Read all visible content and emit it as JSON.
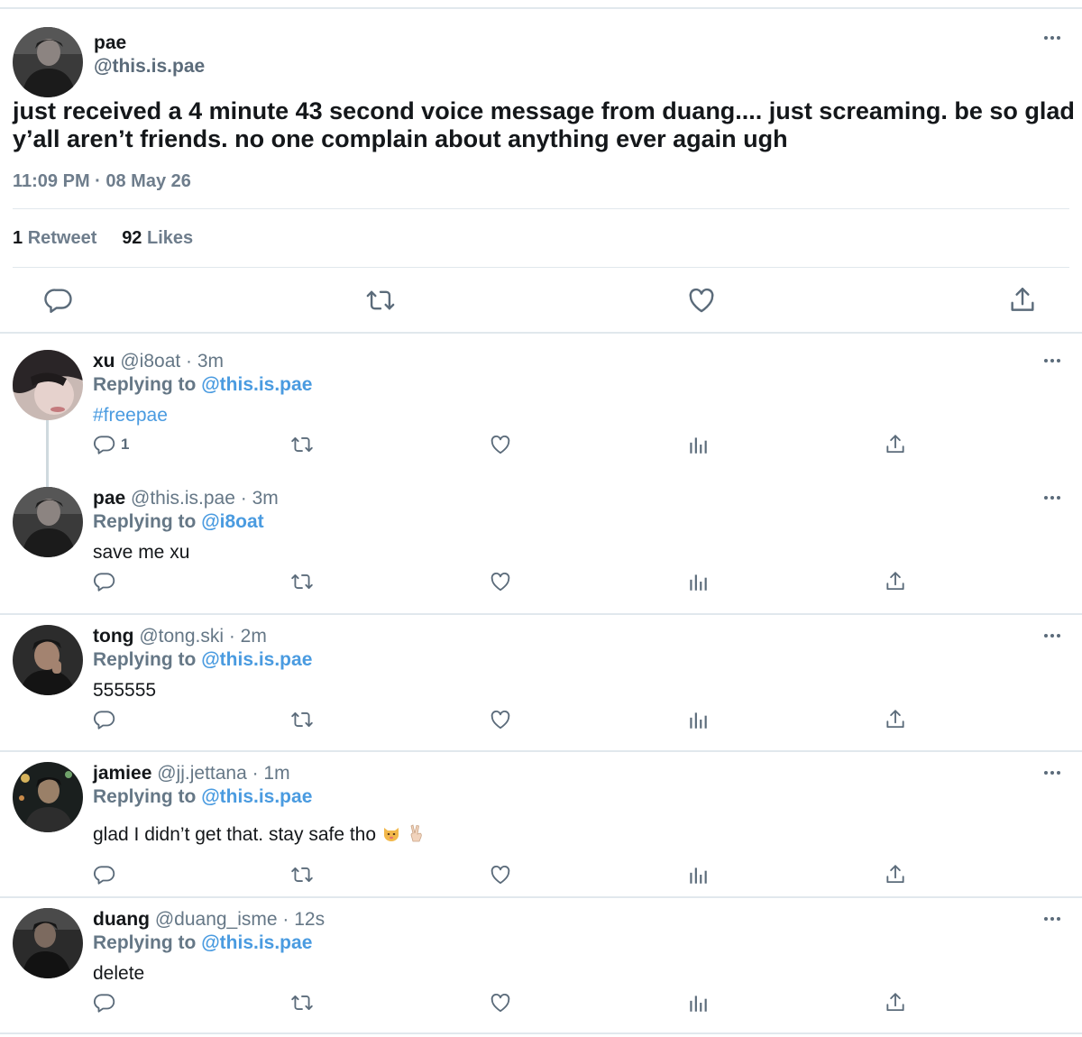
{
  "main_tweet": {
    "author": {
      "name": "pae",
      "handle": "@this.is.pae"
    },
    "text": "just received a 4 minute 43 second voice message from duang.... just screaming. be so glad y’all aren’t friends. no one complain about anything ever again ugh",
    "timestamp": "11:09 PM · 08 May 26",
    "stats": {
      "retweet_count": "1",
      "retweet_label": "Retweet",
      "like_count": "92",
      "like_label": "Likes"
    },
    "actions": [
      "reply-icon",
      "retweet-icon",
      "like-icon",
      "share-icon"
    ]
  },
  "replies": [
    {
      "name": "xu",
      "handle": "@i8oat · 3m",
      "replying_label": "Replying to",
      "replying_to": "@this.is.pae",
      "text": "#freepae",
      "reply_count": "1"
    },
    {
      "name": "pae",
      "handle": "@this.is.pae · 3m",
      "replying_label": "Replying to",
      "replying_to": "@i8oat",
      "text": "save me xu"
    },
    {
      "name": "tong",
      "handle": "@tong.ski · 2m",
      "replying_label": "Replying to",
      "replying_to": "@this.is.pae",
      "text": "555555"
    },
    {
      "name": "jamiee",
      "handle": "@jj.jettana · 1m",
      "replying_label": "Replying to",
      "replying_to": "@this.is.pae",
      "text": "glad I didn’t get that. stay safe tho",
      "emojis": [
        "cat-face-icon",
        "victory-hand-icon"
      ]
    },
    {
      "name": "duang",
      "handle": "@duang_isme · 12s",
      "replying_label": "Replying to",
      "replying_to": "@this.is.pae",
      "text": "delete"
    }
  ],
  "colors": {
    "link": "#4a9be0",
    "muted": "#657786",
    "text": "#14171a",
    "divider": "#e1e8ed"
  }
}
